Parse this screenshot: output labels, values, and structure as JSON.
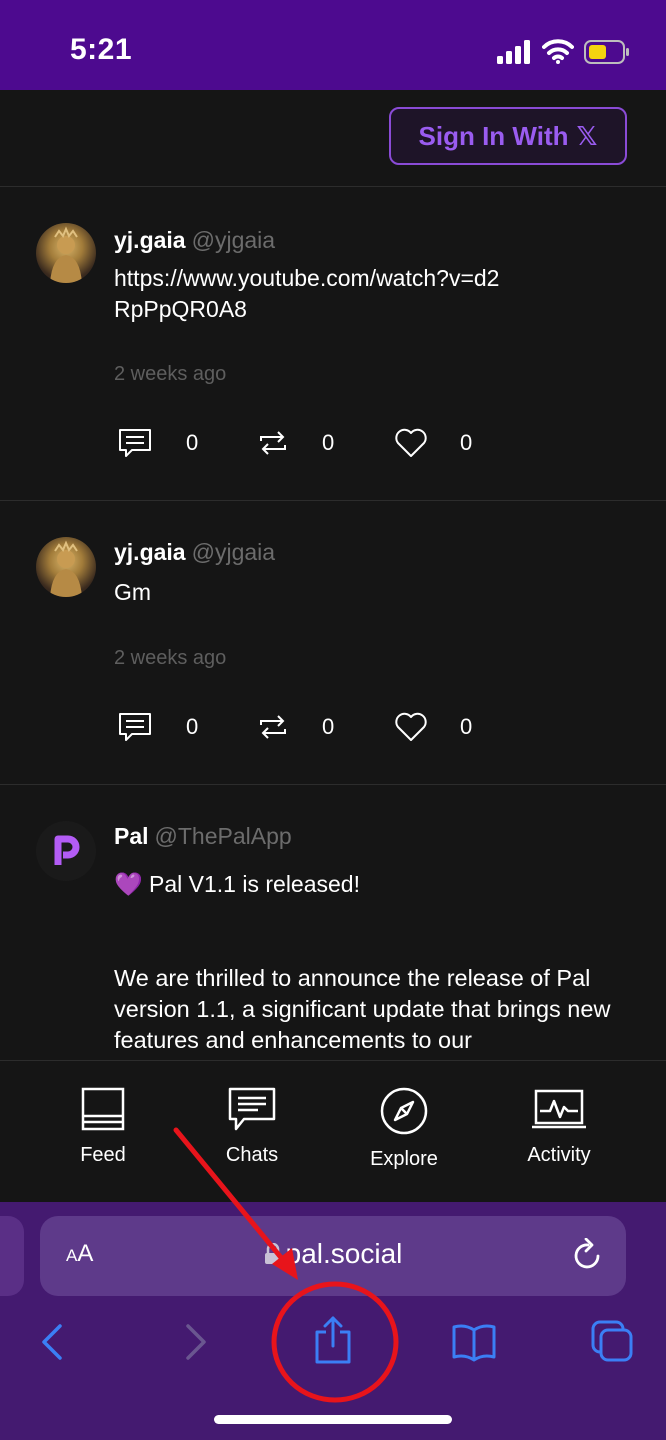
{
  "status_bar": {
    "time": "5:21",
    "signal_icon": "cellular-signal-icon",
    "wifi_icon": "wifi-icon",
    "battery_icon": "battery-low-icon",
    "battery_color": "#f5d30f"
  },
  "header": {
    "sign_in_label": "Sign In With",
    "x_logo": "𝕏",
    "accent": "#9a5cf0"
  },
  "posts": [
    {
      "author": "yj.gaia",
      "handle": "@yjgaia",
      "body": "https://www.youtube.com/watch?v=d2RpPpQR0A8",
      "time": "2 weeks ago",
      "comments": "0",
      "reposts": "0",
      "likes": "0"
    },
    {
      "author": "yj.gaia",
      "handle": "@yjgaia",
      "body": "Gm",
      "time": "2 weeks ago",
      "comments": "0",
      "reposts": "0",
      "likes": "0"
    },
    {
      "author": "Pal",
      "handle": "@ThePalApp",
      "body_line1": "Pal V1.1 is released!",
      "emoji": "💜",
      "body_para2": "We are thrilled to announce the release of Pal version 1.1, a significant update that brings new features and enhancements to our"
    }
  ],
  "tabs": [
    {
      "label": "Feed",
      "icon": "feed-icon"
    },
    {
      "label": "Chats",
      "icon": "chat-icon"
    },
    {
      "label": "Explore",
      "icon": "compass-icon"
    },
    {
      "label": "Activity",
      "icon": "activity-icon"
    }
  ],
  "browser": {
    "text_size_label_small": "A",
    "text_size_label_large": "A",
    "url": "pal.social",
    "tools": [
      "back-icon",
      "forward-icon",
      "share-icon",
      "bookmarks-icon",
      "tabs-icon"
    ],
    "tint": "#3b7ff5"
  },
  "annotation": {
    "color": "#e8141b",
    "target": "share-button"
  }
}
